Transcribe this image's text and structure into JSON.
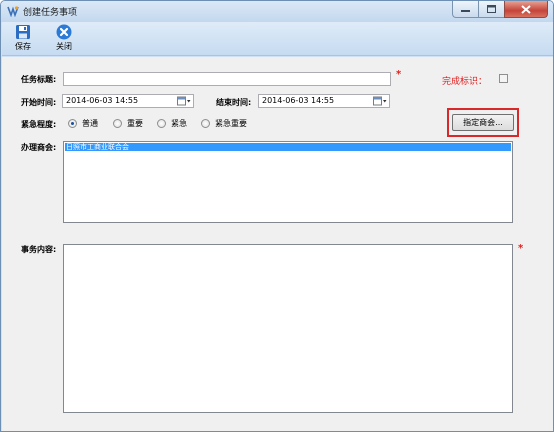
{
  "window": {
    "title": "创建任务事项"
  },
  "toolbar": {
    "save_label": "保存",
    "close_label": "关闭"
  },
  "form": {
    "title_label": "任务标题:",
    "title_value": "",
    "done_label": "完成标识：",
    "done_checked": false,
    "start_label": "开始时间:",
    "start_value": "2014-06-03 14:55",
    "end_label": "结束时间:",
    "end_value": "2014-06-03 14:55",
    "urgency_label": "紧急程度:",
    "urgency_options": [
      "普通",
      "重要",
      "紧急",
      "紧急重要"
    ],
    "urgency_selected": "普通",
    "assign_button": "指定商会...",
    "chamber_label": "办理商会:",
    "chamber_items": [
      "日照市工商业联合会"
    ],
    "content_label": "事务内容:",
    "content_value": "",
    "required_mark": "*"
  },
  "colors": {
    "required": "#e02020",
    "highlight_frame": "#d8282a",
    "selection": "#3399ff"
  }
}
